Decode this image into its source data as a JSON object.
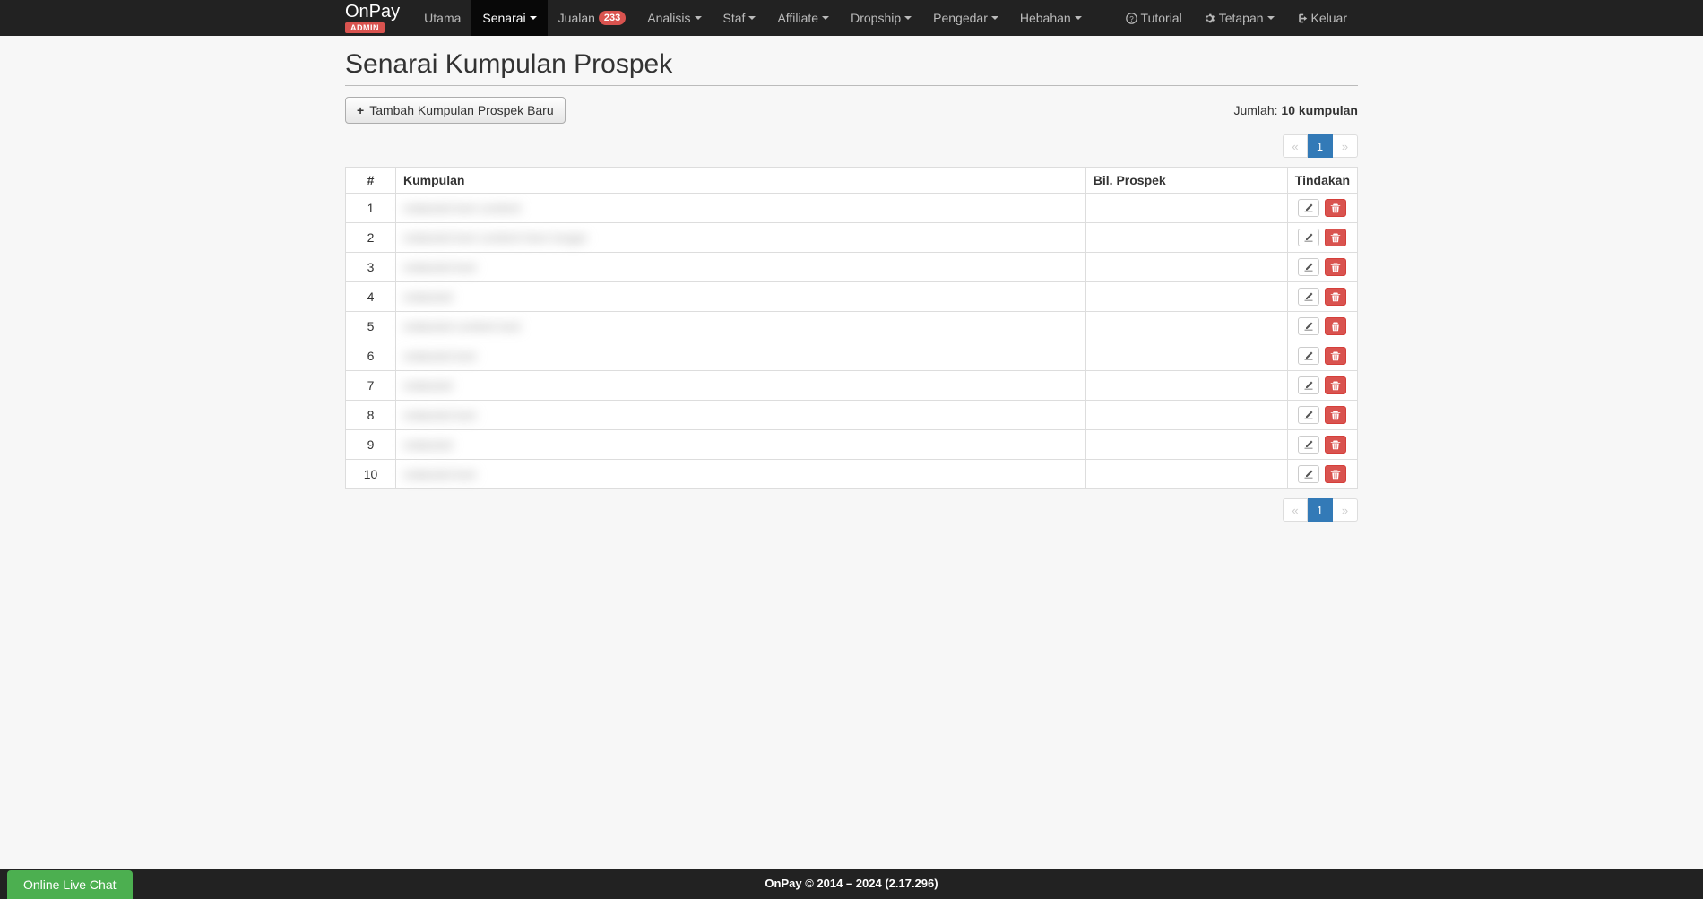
{
  "brand": {
    "name": "OnPay",
    "badge": "ADMIN"
  },
  "nav": {
    "utama": "Utama",
    "senarai": "Senarai",
    "jualan": "Jualan",
    "jualan_badge": "233",
    "analisis": "Analisis",
    "staf": "Staf",
    "affiliate": "Affiliate",
    "dropship": "Dropship",
    "pengedar": "Pengedar",
    "hebahan": "Hebahan",
    "tutorial": "Tutorial",
    "tetapan": "Tetapan",
    "keluar": "Keluar"
  },
  "page": {
    "title": "Senarai Kumpulan Prospek",
    "add_button": "Tambah Kumpulan Prospek Baru",
    "jumlah_label": "Jumlah: ",
    "jumlah_value": "10 kumpulan"
  },
  "pagination": {
    "prev": "«",
    "page": "1",
    "next": "»"
  },
  "table": {
    "headers": {
      "num": "#",
      "kumpulan": "Kumpulan",
      "bil": "Bil. Prospek",
      "tindakan": "Tindakan"
    },
    "rows": [
      {
        "num": "1",
        "kumpulan": "redacted text content",
        "bil": ""
      },
      {
        "num": "2",
        "kumpulan": "redacted text content here longer",
        "bil": ""
      },
      {
        "num": "3",
        "kumpulan": "redacted text",
        "bil": ""
      },
      {
        "num": "4",
        "kumpulan": "redacted",
        "bil": ""
      },
      {
        "num": "5",
        "kumpulan": "redacted content text",
        "bil": ""
      },
      {
        "num": "6",
        "kumpulan": "redacted text",
        "bil": ""
      },
      {
        "num": "7",
        "kumpulan": "redacted",
        "bil": ""
      },
      {
        "num": "8",
        "kumpulan": "redacted text",
        "bil": ""
      },
      {
        "num": "9",
        "kumpulan": "redacted",
        "bil": ""
      },
      {
        "num": "10",
        "kumpulan": "redacted text",
        "bil": ""
      }
    ]
  },
  "footer": {
    "text": "OnPay © 2014 – 2024 (2.17.296)"
  },
  "chat": {
    "label": "Online Live Chat"
  }
}
